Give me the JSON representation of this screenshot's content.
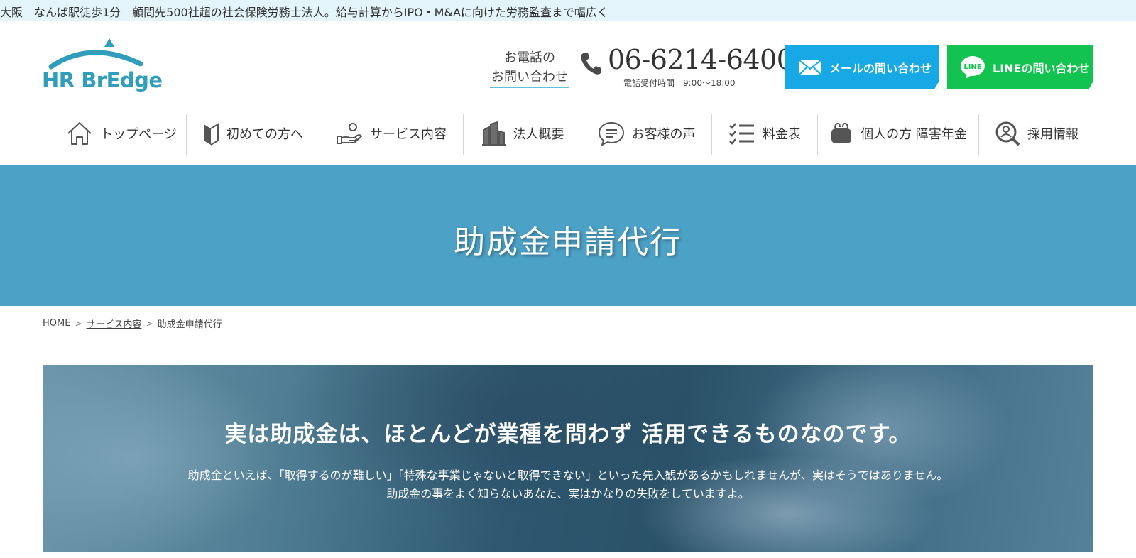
{
  "topbar": {
    "text": "大阪　なんば駅徒歩1分　顧問先500社超の社会保険労務士法人。給与計算からIPO・M&Aに向けた労務監査まで幅広く"
  },
  "logo": {
    "text": "HR BrEdge"
  },
  "header": {
    "tel_label_line1": "お電話の",
    "tel_label_line2": "お問い合わせ",
    "tel_number": "06-6214-6400",
    "tel_hours": "電話受付時間　9:00～18:00",
    "mail_button": "メールの問い合わせ",
    "line_button": "LINEの問い合わせ",
    "line_icon_text": "LINE"
  },
  "nav": {
    "items": [
      {
        "label": "トップページ",
        "icon": "home-icon"
      },
      {
        "label": "初めての方へ",
        "icon": "beginner-mark-icon"
      },
      {
        "label": "サービス内容",
        "icon": "hand-service-icon"
      },
      {
        "label": "法人概要",
        "icon": "building-icon"
      },
      {
        "label": "お客様の声",
        "icon": "speech-bubble-icon"
      },
      {
        "label": "料金表",
        "icon": "checklist-icon"
      },
      {
        "label": "個人の方 障害年金",
        "icon": "purse-icon"
      },
      {
        "label": "採用情報",
        "icon": "user-search-icon"
      }
    ]
  },
  "hero": {
    "title": "助成金申請代行"
  },
  "breadcrumb": {
    "home": "HOME",
    "services": "サービス内容",
    "current": "助成金申請代行",
    "separator": ">"
  },
  "feature": {
    "heading": "実は助成金は、ほとんどが業種を問わず 活用できるものなのです。",
    "line1": "助成金といえば、「取得するのが難しい」「特殊な事業じゃないと取得できない」といった先入観があるかもしれませんが、実はそうではありません。",
    "line2": "助成金の事をよく知らないあなた、実はかなりの失敗をしていますよ。"
  },
  "colors": {
    "accent": "#2f9dbb",
    "hero_bg": "#4ca1c6",
    "topbar_bg": "#e3f4fb",
    "mail_button": "#17a8e6",
    "line_button": "#13c34f"
  }
}
